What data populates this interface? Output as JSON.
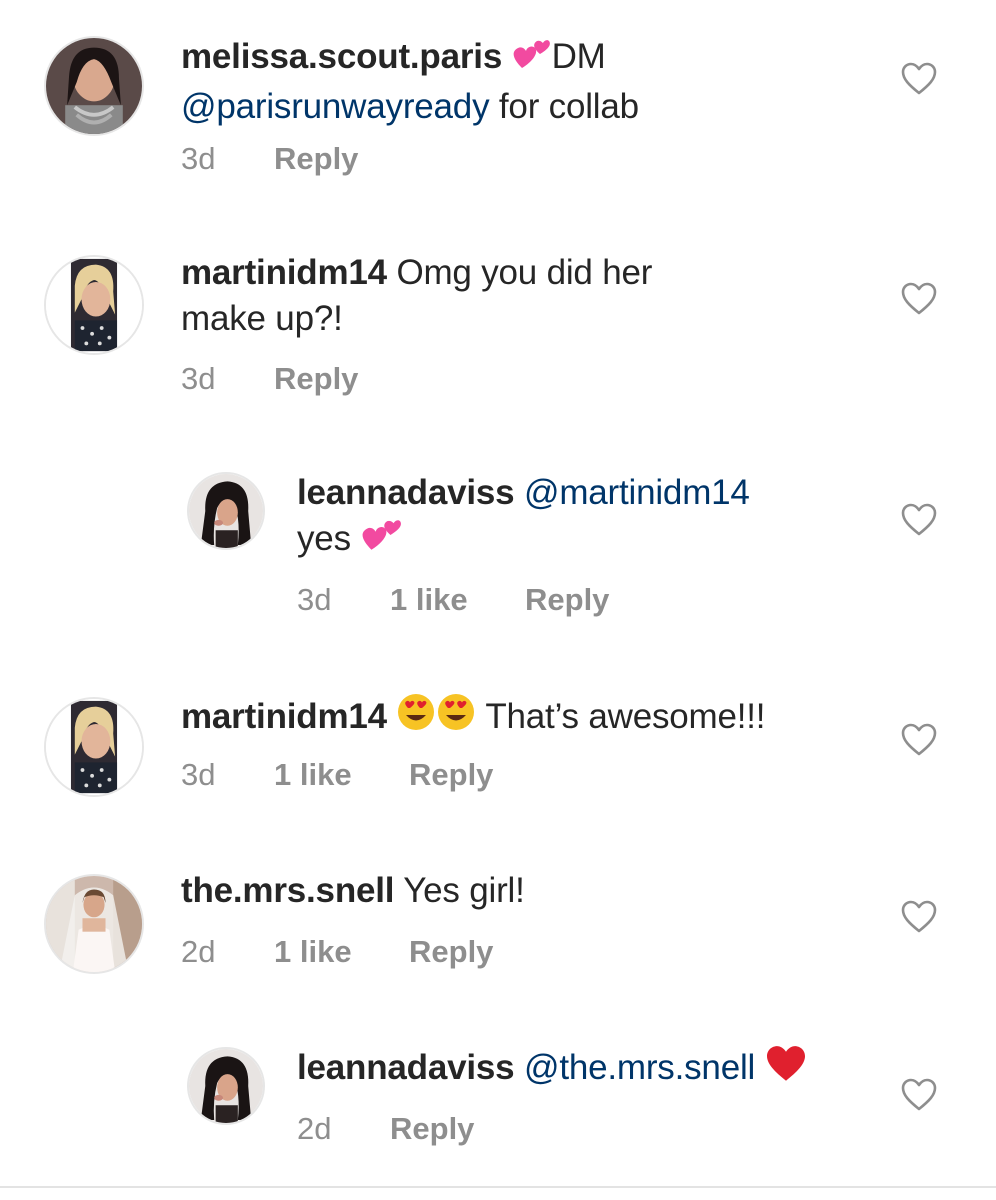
{
  "comments": [
    {
      "username": "melissa.scout.paris",
      "text_before": "",
      "emoji": "two-hearts",
      "text_after": "DM",
      "mention": "@parisrunwayready",
      "text_end": " for collab",
      "time": "3d",
      "reply": "Reply"
    },
    {
      "username": "martinidm14",
      "text": " Omg you did her make up?!",
      "time": "3d",
      "reply": "Reply"
    },
    {
      "username": "leannadaviss",
      "mention": "@martinidm14",
      "text": "yes ",
      "emoji": "two-hearts",
      "time": "3d",
      "likes": "1 like",
      "reply": "Reply"
    },
    {
      "username": "martinidm14",
      "emoji": "heart-eyes-face",
      "text": " That’s awesome!!!",
      "time": "3d",
      "likes": "1 like",
      "reply": "Reply"
    },
    {
      "username": "the.mrs.snell",
      "text": " Yes girl!",
      "time": "2d",
      "likes": "1 like",
      "reply": "Reply"
    },
    {
      "username": "leannadaviss",
      "mention": "@the.mrs.snell",
      "emoji": "red-heart",
      "time": "2d",
      "reply": "Reply"
    }
  ],
  "colors": {
    "text": "#262626",
    "meta": "#8e8e8e",
    "mention": "#003569",
    "heart_outline": "#8e8e8e",
    "emoji_pink": "#f24aa0",
    "emoji_red": "#e0202e",
    "emoji_yellow": "#f7c324"
  }
}
